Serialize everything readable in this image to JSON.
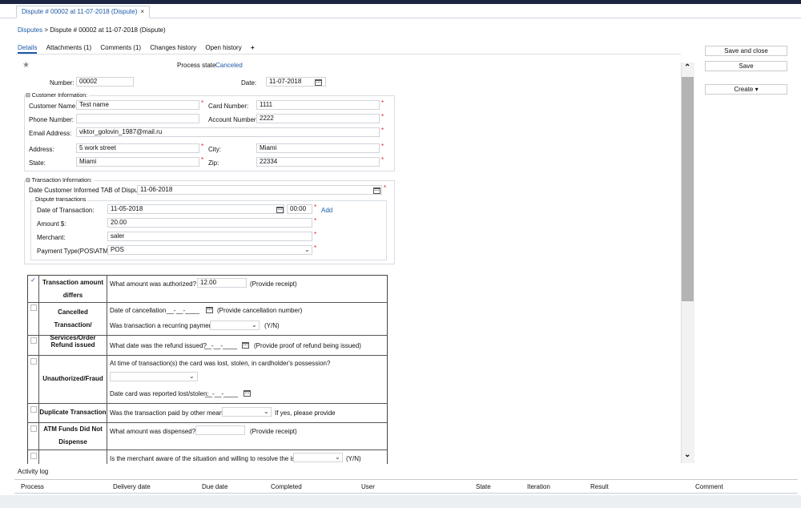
{
  "window": {
    "tab_title": "Dispute # 00002 at 11-07-2018 (Dispute)",
    "tab_close": "×"
  },
  "breadcrumb": {
    "root": "Disputes",
    "separator": ">",
    "current": "Dispute # 00002 at 11-07-2018 (Dispute)"
  },
  "subtabs": [
    {
      "label": "Details",
      "active": true
    },
    {
      "label": "Attachments (1)",
      "active": false
    },
    {
      "label": "Comments (1)",
      "active": false
    },
    {
      "label": "Changes history",
      "active": false
    },
    {
      "label": "Open history",
      "active": false
    },
    {
      "label": "+",
      "active": false
    }
  ],
  "process": {
    "label": "Process state",
    "value": "Canceled"
  },
  "header_fields": {
    "number_label": "Number:",
    "number_value": "00002",
    "date_label": "Date:",
    "date_value": "11-07-2018"
  },
  "customer": {
    "section_title": "⊟ Customer Information:",
    "name_label": "Customer Name:",
    "name_value": "Test name",
    "card_label": "Card Number:",
    "card_value": "1111",
    "phone_label": "Phone Number:",
    "phone_value": "",
    "account_label": "Account Number:",
    "account_value": "2222",
    "email_label": "Email Address:",
    "email_value": "viktor_golovin_1987@mail.ru",
    "address_label": "Address:",
    "address_value": "5 work street",
    "city_label": "City:",
    "city_value": "Miami",
    "state_label": "State:",
    "state_value": "Miami",
    "zip_label": "Zip:",
    "zip_value": "22334"
  },
  "transaction": {
    "section_title": "⊟ Transaction Information:",
    "informed_label": "Date Customer Informed TAB of Dispute:",
    "informed_value": "11-06-2018",
    "dispute_tx_title": "Dispute transactions",
    "date_tx_label": "Date of Transaction:",
    "date_tx_value": "11-05-2018",
    "time_value": "00:00",
    "add_link": "Add",
    "amount_label": "Amount $:",
    "amount_value": "20.00",
    "merchant_label": "Merchant:",
    "merchant_value": "saler",
    "payment_label": "Payment Type(POS\\ATM):",
    "payment_value": "POS"
  },
  "reasons": {
    "r1_title_a": "Transaction amount",
    "r1_title_b": "differs",
    "r1_q": "What amount was authorized? $",
    "r1_value": "12.00",
    "r1_note": "(Provide receipt)",
    "r2_title_a": "Cancelled Transaction/",
    "r2_title_b": "Services/Order",
    "r2_q1": "Date of cancellation",
    "r2_date_placeholder": "__-__-____",
    "r2_note1": "(Provide cancellation number)",
    "r2_q2": "Was transaction a recurring payment?",
    "r2_note2": "(Y/N)",
    "r3_title": "Refund issued",
    "r3_q": "What date was the refund issued?",
    "r3_date_placeholder": "__-__-____",
    "r3_note": "(Provide proof of refund being issued)",
    "r4_title": "Unauthorized/Fraud",
    "r4_q1": "At time of transaction(s) the card was lost, stolen, in cardholder's possession?",
    "r4_q2": "Date card was reported lost/stolen:",
    "r4_date_placeholder": "__-__-____",
    "r5_title": "Duplicate Transaction",
    "r5_q": "Was the transaction paid by other means?",
    "r5_note": "If yes, please provide",
    "r6_title_a": "ATM Funds Did Not",
    "r6_title_b": "Dispense",
    "r6_q": "What amount was dispensed? $",
    "r6_note": "(Provide receipt)",
    "r7_q": "Is the merchant aware of the situation and willing to resolve the issue?",
    "r7_note": "(Y/N)",
    "check_mark": "✓"
  },
  "actions": {
    "save_close": "Save and close",
    "save": "Save",
    "create": "Create",
    "create_caret": "▾"
  },
  "activity": {
    "title": "Activity log",
    "columns": [
      "Process",
      "Delivery date",
      "Due date",
      "Completed",
      "User",
      "State",
      "Iteration",
      "Result",
      "Comment"
    ]
  },
  "colors": {
    "accent": "#1d5aa8",
    "required": "#dd2222",
    "topbar": "#1c2541"
  }
}
